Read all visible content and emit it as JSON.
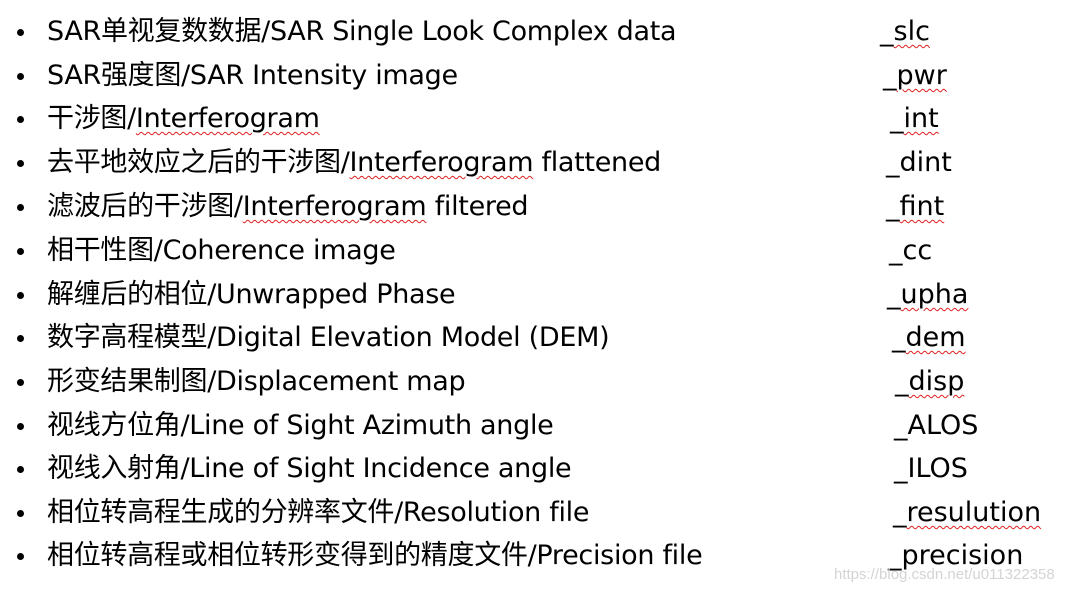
{
  "items": [
    {
      "cn": "SAR单视复数数据/",
      "en": "SAR Single Look Complex data",
      "en_sq": "",
      "en_rest": "",
      "suffix_prefix": "_",
      "suffix": "slc",
      "suffix_spellcheck": true
    },
    {
      "cn": "SAR强度图/",
      "en": "SAR Intensity image",
      "en_sq": "",
      "en_rest": "",
      "suffix_prefix": "_",
      "suffix": "pwr",
      "suffix_spellcheck": true
    },
    {
      "cn": "干涉图/",
      "en": "",
      "en_sq": "Interferogram",
      "en_rest": "",
      "suffix_prefix": "_",
      "suffix": "int",
      "suffix_spellcheck": true
    },
    {
      "cn": "去平地效应之后的干涉图/",
      "en": "",
      "en_sq": "Interferogram",
      "en_rest": " flattened",
      "suffix_prefix": "_",
      "suffix": "dint",
      "suffix_spellcheck": false
    },
    {
      "cn": "滤波后的干涉图/",
      "en": "",
      "en_sq": "Interferogram",
      "en_rest": " filtered",
      "suffix_prefix": "_",
      "suffix": "fint",
      "suffix_spellcheck": true
    },
    {
      "cn": "相干性图/",
      "en": "Coherence image",
      "en_sq": "",
      "en_rest": "",
      "suffix_prefix": "_",
      "suffix": "cc",
      "suffix_spellcheck": false
    },
    {
      "cn": "解缠后的相位/",
      "en": "Unwrapped Phase",
      "en_sq": "",
      "en_rest": "",
      "suffix_prefix": "_",
      "suffix": "upha",
      "suffix_spellcheck": true
    },
    {
      "cn": "数字高程模型/",
      "en": "Digital Elevation Model (DEM)",
      "en_sq": "",
      "en_rest": "",
      "suffix_prefix": "_",
      "suffix": "dem",
      "suffix_spellcheck": true
    },
    {
      "cn": "形变结果制图/",
      "en": "Displacement map",
      "en_sq": "",
      "en_rest": "",
      "suffix_prefix": "_",
      "suffix": "disp",
      "suffix_spellcheck": true
    },
    {
      "cn": "视线方位角/",
      "en": "Line of Sight Azimuth angle",
      "en_sq": "",
      "en_rest": "",
      "suffix_prefix": "_",
      "suffix": "ALOS",
      "suffix_spellcheck": false
    },
    {
      "cn": "视线入射角/",
      "en": "Line of Sight Incidence angle",
      "en_sq": "",
      "en_rest": "",
      "suffix_prefix": "_",
      "suffix": "ILOS",
      "suffix_spellcheck": false
    },
    {
      "cn": "相位转高程生成的分辨率文件/",
      "en": "Resolution file",
      "en_sq": "",
      "en_rest": "",
      "suffix_prefix": "_",
      "suffix": "resulution",
      "suffix_spellcheck": true
    },
    {
      "cn": "相位转高程或相位转形变得到的精度文件/",
      "en": "Precision file",
      "en_sq": "",
      "en_rest": "",
      "suffix_prefix": "_",
      "suffix": "precision",
      "suffix_spellcheck": false
    }
  ],
  "watermark": "https://blog.csdn.net/u011322358",
  "colors": {
    "text": "#000000",
    "spellcheck": "#e02020",
    "watermark": "#d4d4d4"
  }
}
